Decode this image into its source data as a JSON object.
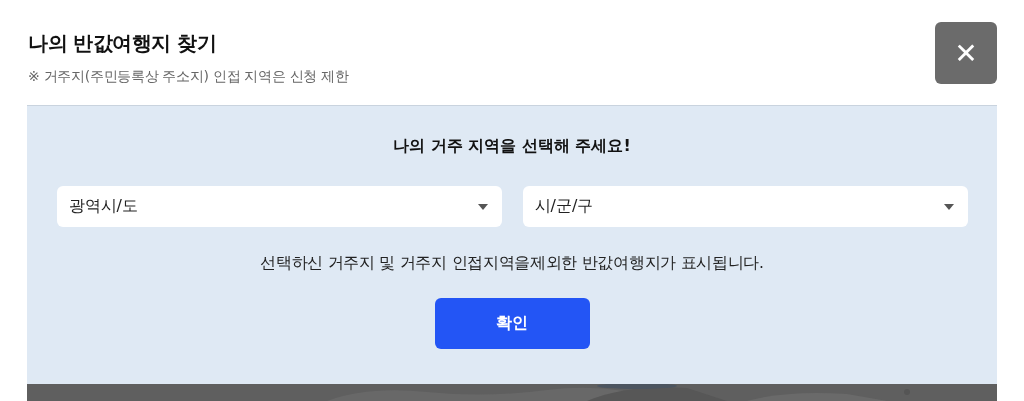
{
  "header": {
    "title": "나의 반값여행지 찾기",
    "notice": "※ 거주지(주민등록상 주소지) 인접 지역은 신청 제한",
    "close": "✕"
  },
  "panel": {
    "heading": "나의 거주 지역을 선택해 주세요!",
    "selects": [
      {
        "placeholder": "광역시/도"
      },
      {
        "placeholder": "시/군/구"
      }
    ],
    "description": "선택하신 거주지 및 거주지 인접지역을제외한 반값여행지가 표시됩니다.",
    "confirm": "확인"
  }
}
